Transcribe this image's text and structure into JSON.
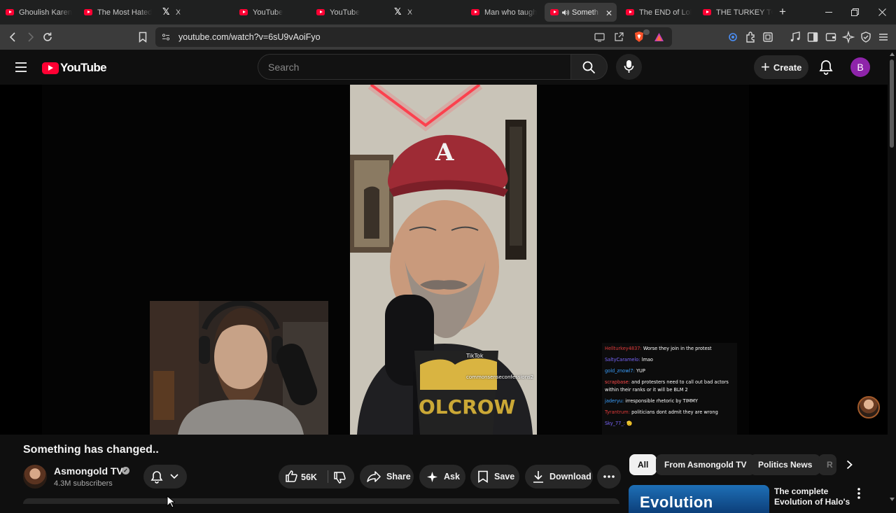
{
  "browser": {
    "tabs": [
      {
        "title": "Ghoulish Karen",
        "favicon": "youtube-icon"
      },
      {
        "title": "The Most Hated",
        "favicon": "youtube-icon"
      },
      {
        "title": "X",
        "favicon": "x-icon"
      },
      {
        "title": "YouTube",
        "favicon": "youtube-icon"
      },
      {
        "title": "YouTube",
        "favicon": "youtube-icon"
      },
      {
        "title": "X",
        "favicon": "x-icon"
      },
      {
        "title": "Man who taugh",
        "favicon": "youtube-icon"
      },
      {
        "title": "Someth",
        "favicon": "youtube-icon",
        "active": true,
        "audio": true
      },
      {
        "title": "The END of Lol",
        "favicon": "youtube-icon"
      },
      {
        "title": "THE TURKEY TO",
        "favicon": "youtube-icon"
      }
    ],
    "close_tab_symbol": "✕",
    "new_tab_symbol": "+",
    "url": "youtube.com/watch?v=6sU9vAoiFyo"
  },
  "youtube": {
    "logo_text": "YouTube",
    "search_placeholder": "Search",
    "create_label": "Create",
    "avatar_letter": "B"
  },
  "video": {
    "title": "Something has changed..",
    "overlay": {
      "tiktok_label": "TikTok",
      "tiktok_handle": "commonsenseconfessions2",
      "chat": [
        {
          "user": "Hellturkey4837:",
          "text": "Worse they join in the protest"
        },
        {
          "user": "SaltyCaramelo:",
          "text": "lmao"
        },
        {
          "user": "gold_znowl7:",
          "text": "YUP"
        },
        {
          "user": "scrapbase:",
          "text": "and protesters need to call out bad actors within their ranks or it will be BLM 2"
        },
        {
          "user": "jaderyu:",
          "text": "irresponsible rhetoric by TIMMY"
        },
        {
          "user": "Tyrantrum:",
          "text": "politicians dont admit they are wrong"
        },
        {
          "user": "Sky_77_:",
          "text": "🫡"
        }
      ]
    }
  },
  "channel": {
    "name": "Asmongold TV",
    "subscribers": "4.3M subscribers"
  },
  "actions": {
    "likes": "56K",
    "share": "Share",
    "ask": "Ask",
    "save": "Save",
    "download": "Download"
  },
  "chips": [
    "All",
    "From Asmongold TV",
    "Politics News",
    "R"
  ],
  "recommendation": {
    "thumb_text": "Evolution",
    "title": "The complete Evolution of Halo's"
  },
  "colors": {
    "background": "#0f0f0f",
    "youtube_red": "#ff0033",
    "avatar_purple": "#8e24aa",
    "pill_bg": "#272727"
  }
}
